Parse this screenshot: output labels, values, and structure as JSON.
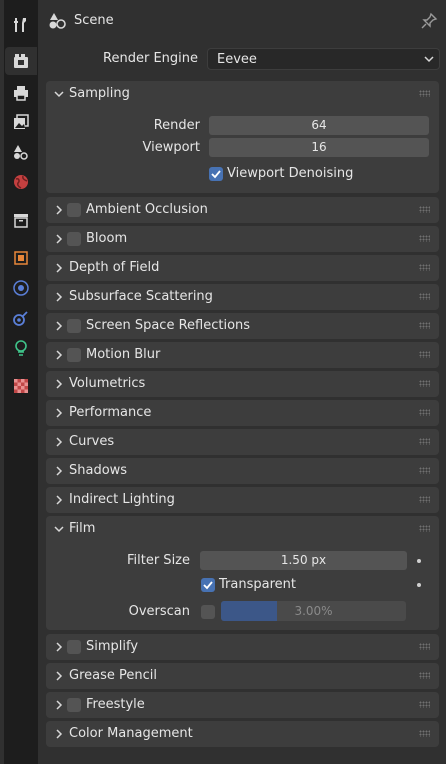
{
  "tabs": [
    {
      "icon": "tool-icon",
      "active": false
    },
    {
      "icon": "render-icon",
      "active": true
    },
    {
      "icon": "output-icon",
      "active": false
    },
    {
      "icon": "view-layer-icon",
      "active": false
    },
    {
      "icon": "scene-icon",
      "active": false
    },
    {
      "icon": "world-icon",
      "active": false
    },
    {
      "icon": "collection-icon",
      "active": false
    },
    {
      "icon": "object-icon",
      "active": false
    },
    {
      "icon": "physics-icon",
      "active": false
    },
    {
      "icon": "constraint-icon",
      "active": false
    },
    {
      "icon": "data-icon",
      "active": false
    },
    {
      "icon": "texture-icon",
      "active": false
    }
  ],
  "header": {
    "title": "Scene"
  },
  "render_engine": {
    "label": "Render Engine",
    "value": "Eevee"
  },
  "sampling": {
    "title": "Sampling",
    "render_label": "Render",
    "render_value": "64",
    "viewport_label": "Viewport",
    "viewport_value": "16",
    "denoise_label": "Viewport Denoising",
    "denoise_checked": true
  },
  "panels": {
    "ambient_occlusion": "Ambient Occlusion",
    "bloom": "Bloom",
    "depth_of_field": "Depth of Field",
    "subsurface_scattering": "Subsurface Scattering",
    "screen_space_reflections": "Screen Space Reflections",
    "motion_blur": "Motion Blur",
    "volumetrics": "Volumetrics",
    "performance": "Performance",
    "curves": "Curves",
    "shadows": "Shadows",
    "indirect_lighting": "Indirect Lighting",
    "simplify": "Simplify",
    "grease_pencil": "Grease Pencil",
    "freestyle": "Freestyle",
    "color_management": "Color Management"
  },
  "film": {
    "title": "Film",
    "filter_size_label": "Filter Size",
    "filter_size_value": "1.50 px",
    "transparent_label": "Transparent",
    "transparent_checked": true,
    "overscan_label": "Overscan",
    "overscan_checked": false,
    "overscan_value": "3.00%",
    "overscan_fraction": 0.3
  },
  "colors": {
    "accent": "#4772b3",
    "panel": "#3d3d3d",
    "background": "#303030"
  }
}
